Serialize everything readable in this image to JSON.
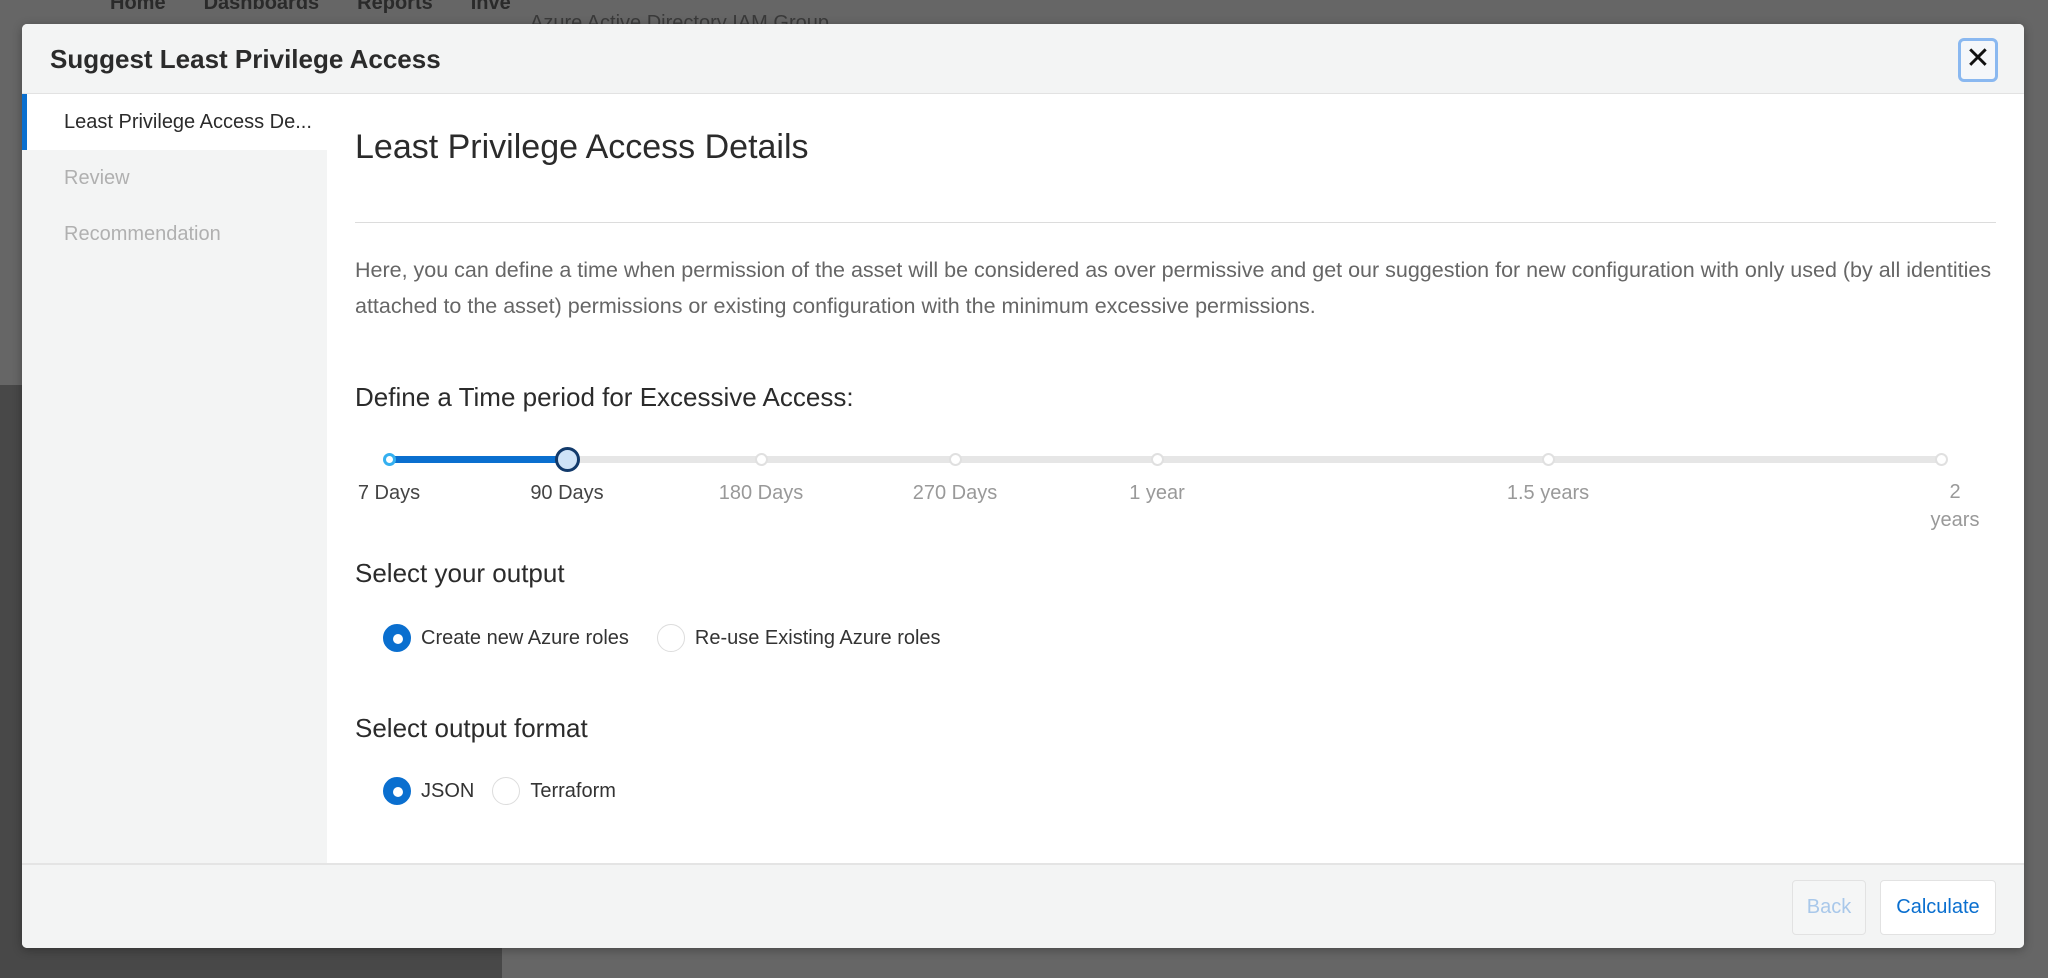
{
  "background": {
    "nav": [
      "Home",
      "Dashboards",
      "Reports",
      "Inve"
    ],
    "subtitle": "Azure Active Directory IAM Group"
  },
  "modal": {
    "title": "Suggest Least Privilege Access",
    "close_icon": "close-x-icon",
    "steps": [
      {
        "label": "Least Privilege Access De...",
        "active": true
      },
      {
        "label": "Review",
        "active": false
      },
      {
        "label": "Recommendation",
        "active": false
      }
    ],
    "content": {
      "heading": "Least Privilege Access Details",
      "description": "Here, you can define a time when permission of the asset will be considered as over permissive and get our suggestion for new configuration with only used (by all identities attached to the asset) permissions or existing configuration with the minimum excessive permissions.",
      "time_period": {
        "label": "Define a Time period for Excessive Access:",
        "options": [
          "7 Days",
          "90 Days",
          "180 Days",
          "270 Days",
          "1 year",
          "1.5 years",
          "2 years"
        ],
        "selected": "90 Days"
      },
      "output": {
        "label": "Select your output",
        "options": [
          "Create new Azure roles",
          "Re-use Existing Azure roles"
        ],
        "selected": "Create new Azure roles"
      },
      "format": {
        "label": "Select output format",
        "options": [
          "JSON",
          "Terraform"
        ],
        "selected": "JSON"
      }
    },
    "footer": {
      "back_label": "Back",
      "calculate_label": "Calculate"
    },
    "colors": {
      "accent": "#0a6fcf",
      "overlay": "#666666"
    }
  }
}
